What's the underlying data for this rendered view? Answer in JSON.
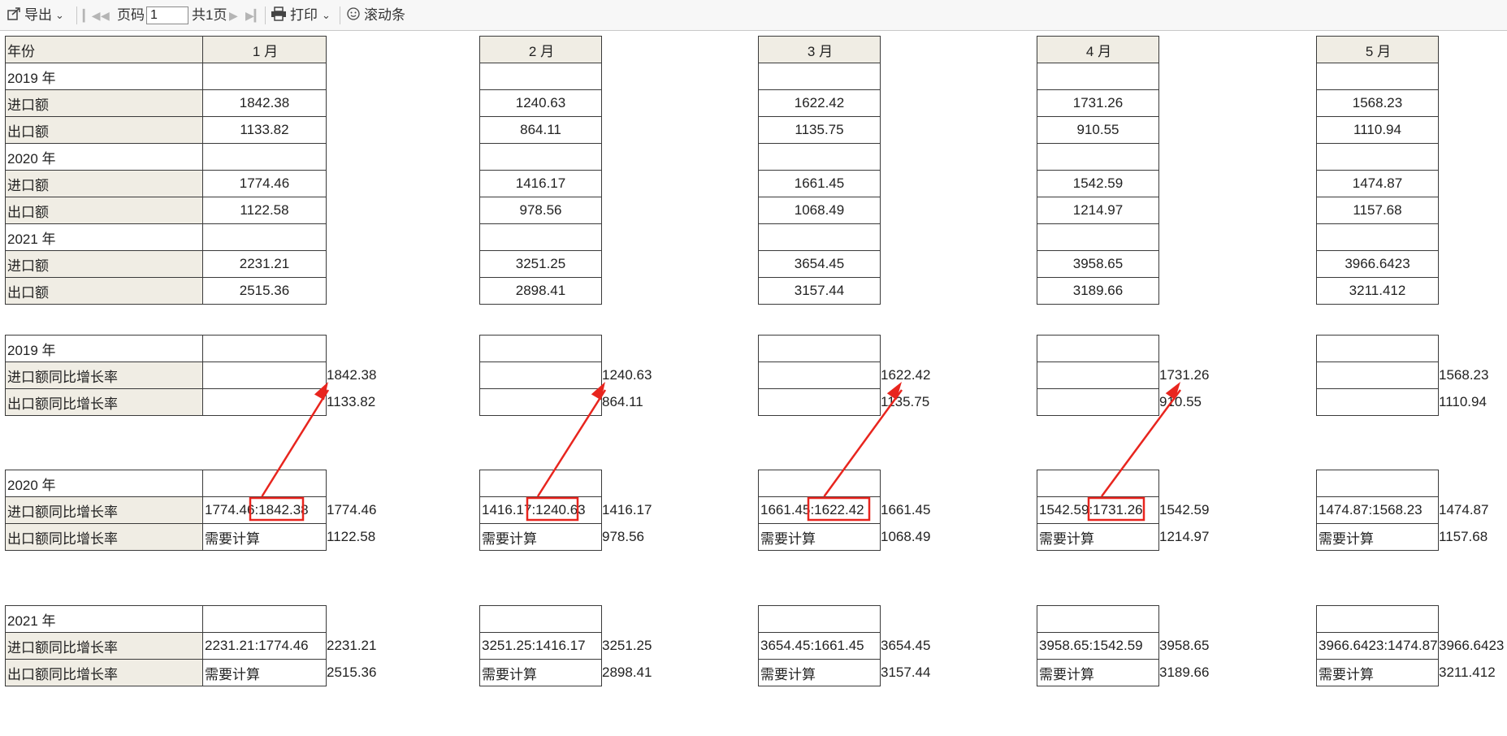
{
  "toolbar": {
    "export_label": "导出",
    "page_label": "页码",
    "page_value": "1",
    "total_pages": "共1页",
    "print_label": "打印",
    "scrollbar_label": "滚动条"
  },
  "labels": {
    "year_header": "年份",
    "import": "进口额",
    "export": "出口额",
    "import_growth": "进口额同比增长率",
    "export_growth": "出口额同比增长率",
    "needs_calc": "需要计算"
  },
  "months": [
    {
      "name": "1 月",
      "years": [
        {
          "year": "2019 年",
          "import": "1842.38",
          "export": "1133.82"
        },
        {
          "year": "2020 年",
          "import": "1774.46",
          "export": "1122.58"
        },
        {
          "year": "2021 年",
          "import": "2231.21",
          "export": "2515.36"
        }
      ],
      "growth": [
        {
          "import_ratio": "",
          "export_ratio": "",
          "side_import": "1842.38",
          "side_export": "1133.82"
        },
        {
          "import_ratio": "1774.46:1842.38",
          "export_ratio": "需要计算",
          "side_import": "1774.46",
          "side_export": "1122.58"
        },
        {
          "import_ratio": "2231.21:1774.46",
          "export_ratio": "需要计算",
          "side_import": "2231.21",
          "side_export": "2515.36"
        }
      ]
    },
    {
      "name": "2 月",
      "years": [
        {
          "year": "2019 年",
          "import": "1240.63",
          "export": "864.11"
        },
        {
          "year": "2020 年",
          "import": "1416.17",
          "export": "978.56"
        },
        {
          "year": "2021 年",
          "import": "3251.25",
          "export": "2898.41"
        }
      ],
      "growth": [
        {
          "import_ratio": "",
          "export_ratio": "",
          "side_import": "1240.63",
          "side_export": "864.11"
        },
        {
          "import_ratio": "1416.17:1240.63",
          "export_ratio": "需要计算",
          "side_import": "1416.17",
          "side_export": "978.56"
        },
        {
          "import_ratio": "3251.25:1416.17",
          "export_ratio": "需要计算",
          "side_import": "3251.25",
          "side_export": "2898.41"
        }
      ]
    },
    {
      "name": "3 月",
      "years": [
        {
          "year": "2019 年",
          "import": "1622.42",
          "export": "1135.75"
        },
        {
          "year": "2020 年",
          "import": "1661.45",
          "export": "1068.49"
        },
        {
          "year": "2021 年",
          "import": "3654.45",
          "export": "3157.44"
        }
      ],
      "growth": [
        {
          "import_ratio": "",
          "export_ratio": "",
          "side_import": "1622.42",
          "side_export": "1135.75"
        },
        {
          "import_ratio": "1661.45:1622.42",
          "export_ratio": "需要计算",
          "side_import": "1661.45",
          "side_export": "1068.49"
        },
        {
          "import_ratio": "3654.45:1661.45",
          "export_ratio": "需要计算",
          "side_import": "3654.45",
          "side_export": "3157.44"
        }
      ]
    },
    {
      "name": "4 月",
      "years": [
        {
          "year": "2019 年",
          "import": "1731.26",
          "export": "910.55"
        },
        {
          "year": "2020 年",
          "import": "1542.59",
          "export": "1214.97"
        },
        {
          "year": "2021 年",
          "import": "3958.65",
          "export": "3189.66"
        }
      ],
      "growth": [
        {
          "import_ratio": "",
          "export_ratio": "",
          "side_import": "1731.26",
          "side_export": "910.55"
        },
        {
          "import_ratio": "1542.59:1731.26",
          "export_ratio": "需要计算",
          "side_import": "1542.59",
          "side_export": "1214.97"
        },
        {
          "import_ratio": "3958.65:1542.59",
          "export_ratio": "需要计算",
          "side_import": "3958.65",
          "side_export": "3189.66"
        }
      ]
    },
    {
      "name": "5 月",
      "years": [
        {
          "year": "2019 年",
          "import": "1568.23",
          "export": "1110.94"
        },
        {
          "year": "2020 年",
          "import": "1474.87",
          "export": "1157.68"
        },
        {
          "year": "2021 年",
          "import": "3966.6423",
          "export": "3211.412"
        }
      ],
      "growth": [
        {
          "import_ratio": "",
          "export_ratio": "",
          "side_import": "1568.23",
          "side_export": "1110.94"
        },
        {
          "import_ratio": "1474.87:1568.23",
          "export_ratio": "需要计算",
          "side_import": "1474.87",
          "side_export": "1157.68"
        },
        {
          "import_ratio": "3966.6423:1474.87",
          "export_ratio": "需要计算",
          "side_import": "3966.6423",
          "side_export": "3211.412"
        }
      ]
    }
  ],
  "annotation_color": "#e8251e"
}
